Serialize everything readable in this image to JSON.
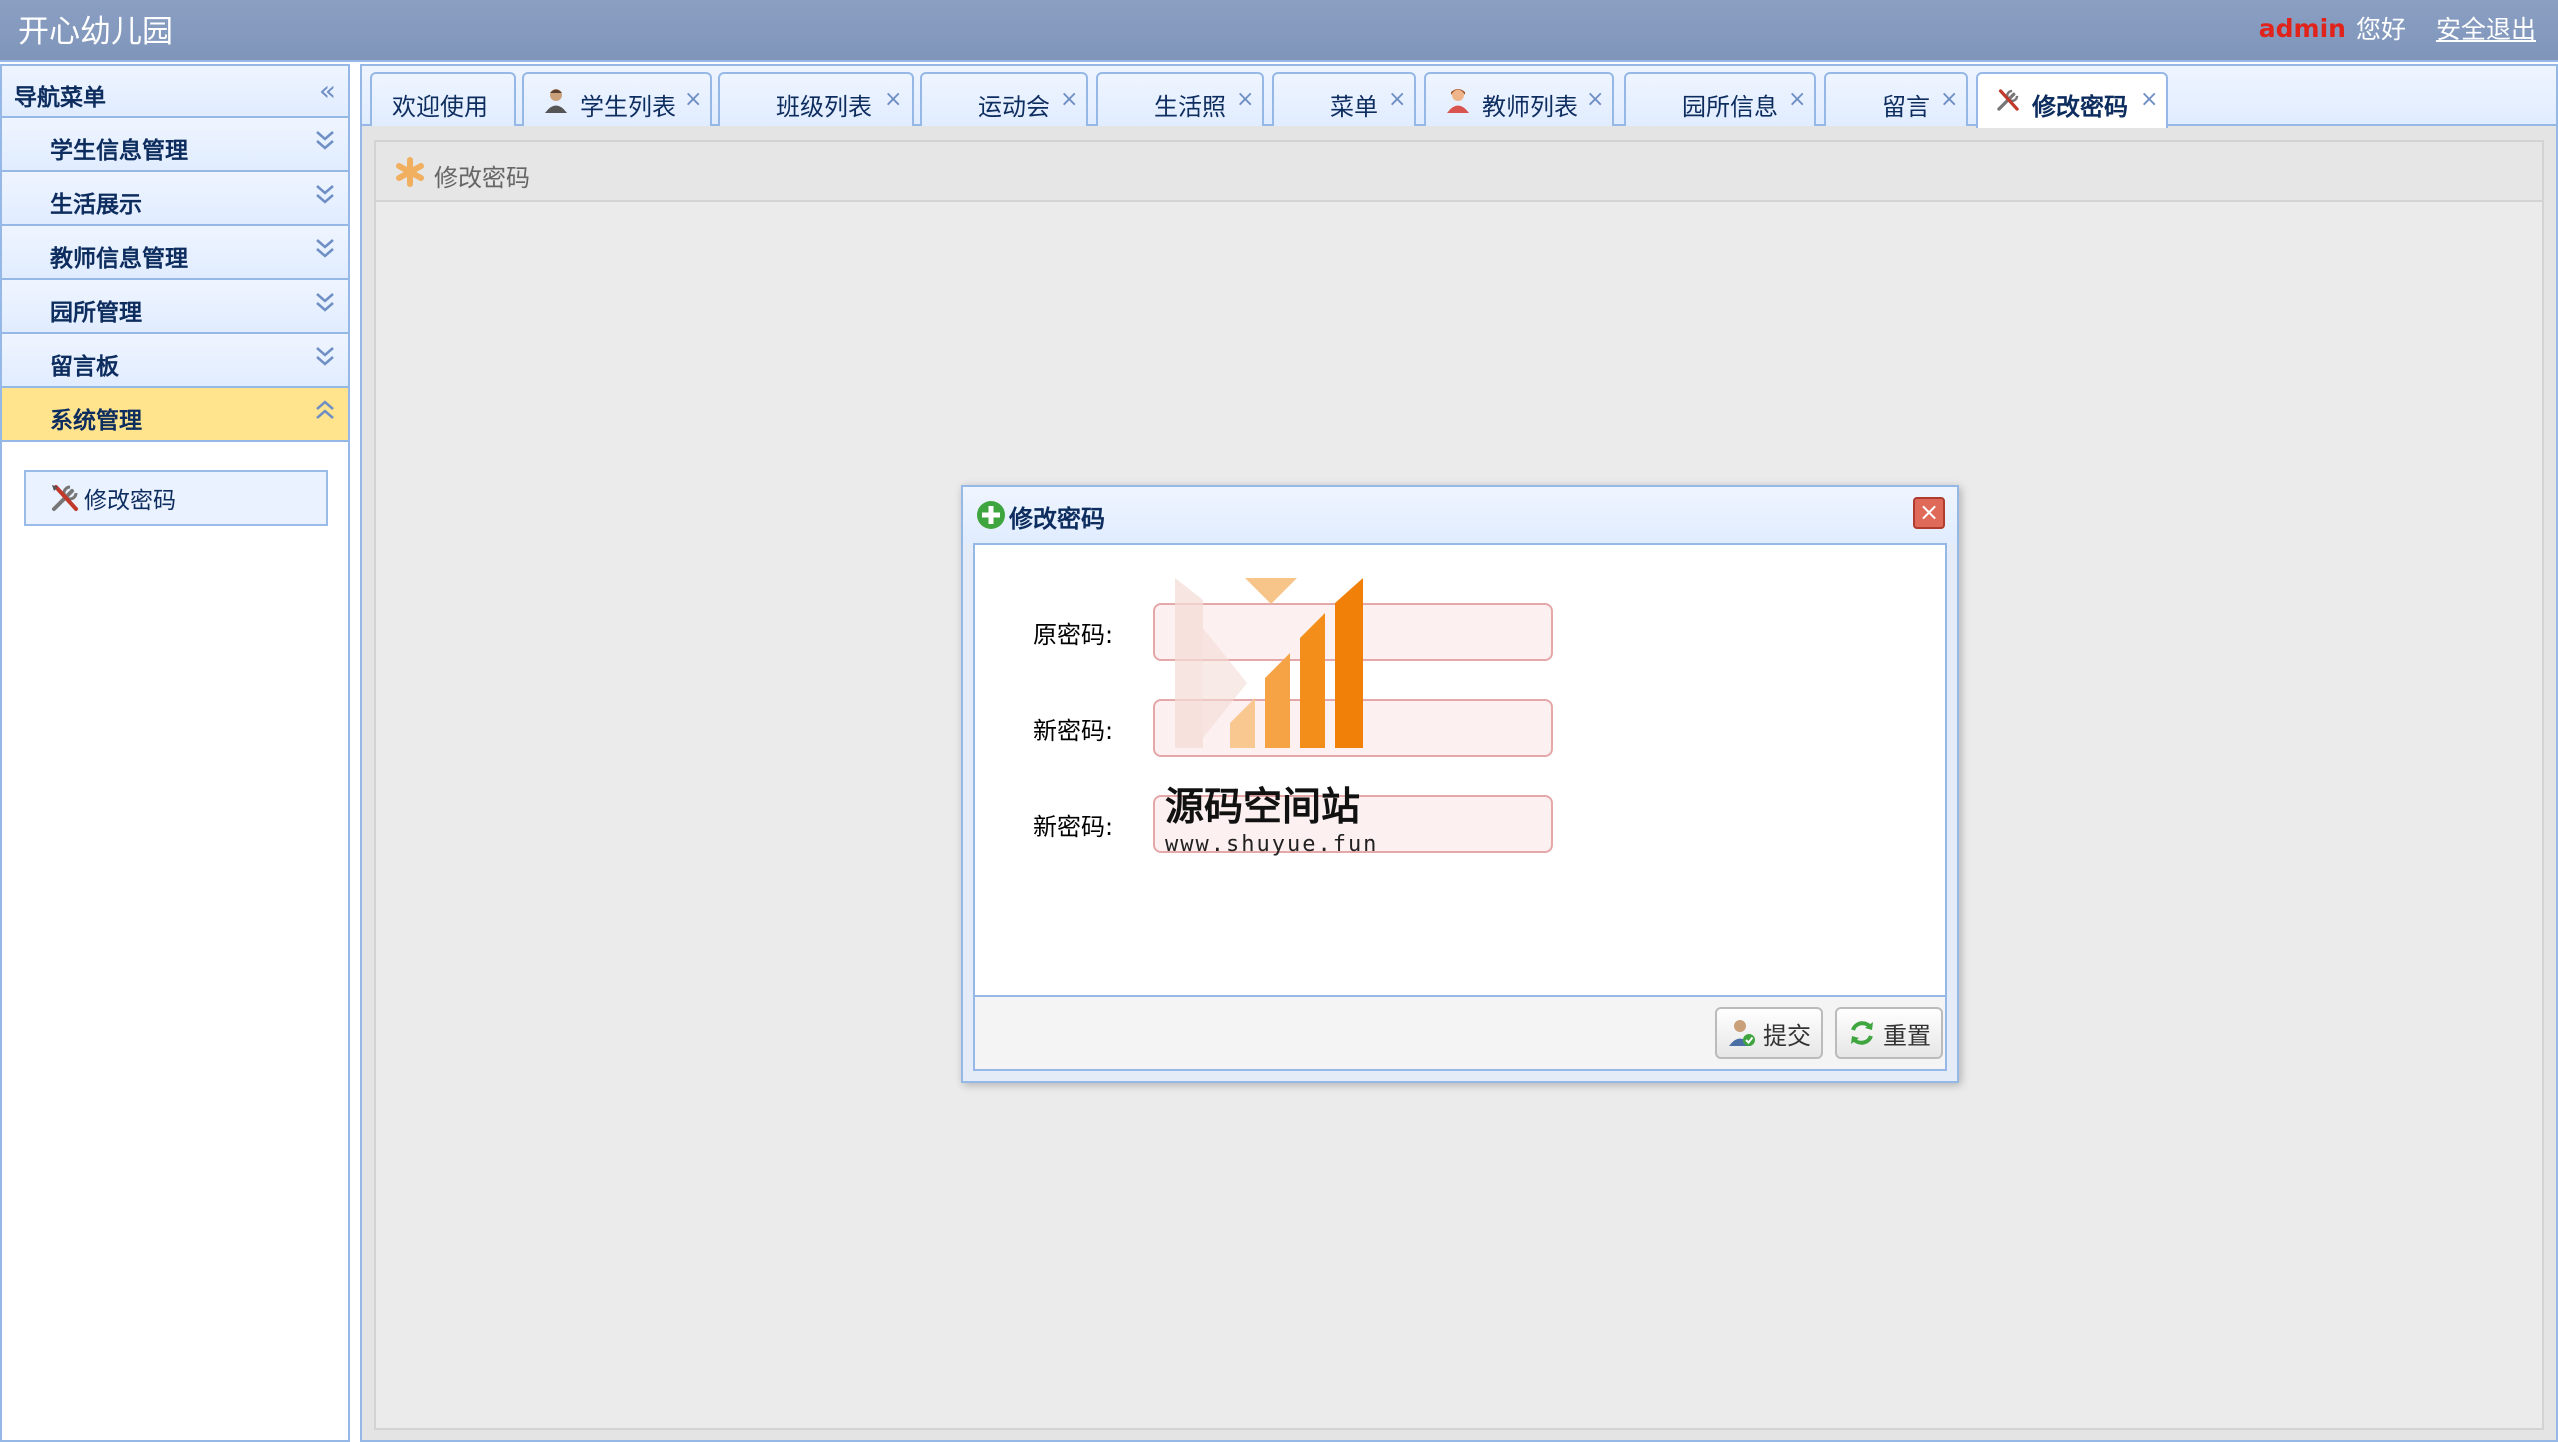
{
  "header": {
    "app_title": "开心幼儿园",
    "user_name": "admin",
    "greeting": "您好",
    "logout_label": "安全退出"
  },
  "sidebar": {
    "title": "导航菜单",
    "groups": [
      {
        "label": "学生信息管理",
        "expanded": false
      },
      {
        "label": "生活展示",
        "expanded": false
      },
      {
        "label": "教师信息管理",
        "expanded": false
      },
      {
        "label": "园所管理",
        "expanded": false
      },
      {
        "label": "留言板",
        "expanded": false
      },
      {
        "label": "系统管理",
        "expanded": true
      }
    ],
    "sub_item": {
      "label": "修改密码",
      "icon": "tools-icon"
    }
  },
  "tabs": [
    {
      "label": "欢迎使用",
      "icon": null,
      "closable": false
    },
    {
      "label": "学生列表",
      "icon": "student-icon",
      "closable": true
    },
    {
      "label": "班级列表",
      "icon": null,
      "closable": true
    },
    {
      "label": "运动会",
      "icon": null,
      "closable": true
    },
    {
      "label": "生活照",
      "icon": null,
      "closable": true
    },
    {
      "label": "菜单",
      "icon": null,
      "closable": true
    },
    {
      "label": "教师列表",
      "icon": "teacher-icon",
      "closable": true
    },
    {
      "label": "园所信息",
      "icon": null,
      "closable": true
    },
    {
      "label": "留言",
      "icon": null,
      "closable": true
    },
    {
      "label": "修改密码",
      "icon": "tools-icon",
      "closable": true,
      "selected": true
    }
  ],
  "panel": {
    "title": "修改密码",
    "icon": "asterisk-icon"
  },
  "dialog": {
    "title": "修改密码",
    "icon": "add-icon",
    "fields": [
      {
        "label": "原密码:",
        "value": "",
        "placeholder": ""
      },
      {
        "label": "新密码:",
        "value": "",
        "placeholder": ""
      },
      {
        "label": "新密码:",
        "value": "",
        "placeholder": ""
      }
    ],
    "submit_label": "提交",
    "reset_label": "重置"
  },
  "watermark": {
    "text": "源码空间站",
    "url": "www.shuyue.fun"
  },
  "colors": {
    "header_bg": "#8a9fc2",
    "accent_border": "#95b8e7",
    "active_nav": "#ffe48d",
    "user_name": "#e0241b",
    "input_border": "#e5a8a8",
    "input_bg": "#fdf0f0"
  }
}
